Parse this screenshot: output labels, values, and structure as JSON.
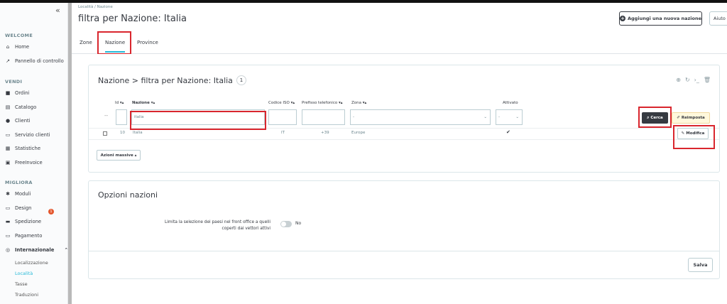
{
  "sidebar": {
    "collapse_icon": "«",
    "sections": {
      "welcome": "WELCOME",
      "vendi": "VENDI",
      "migliora": "MIGLIORA"
    },
    "items": {
      "home": "Home",
      "pannello": "Pannello di controllo",
      "ordini": "Ordini",
      "catalogo": "Catalogo",
      "clienti": "Clienti",
      "servizio": "Servizio clienti",
      "statistiche": "Statistiche",
      "freeinvoice": "FreeInvoice",
      "moduli": "Moduli",
      "design": "Design",
      "spedizione": "Spedizione",
      "pagamento": "Pagamento",
      "internazionale": "Internazionale"
    },
    "design_badge": "1",
    "subitems": {
      "localizzazione": "Localizzazione",
      "localita": "Località",
      "tasse": "Tasse",
      "traduzioni": "Traduzioni"
    }
  },
  "header": {
    "breadcrumb": "Località  /  Nazione",
    "title": "filtra per Nazione: Italia",
    "add_button": "Aggiungi una nuova nazione",
    "help_button": "Aiuto"
  },
  "tabs": {
    "zone": "Zone",
    "nazione": "Nazione",
    "province": "Province"
  },
  "list": {
    "heading": "Nazione > filtra per Nazione: Italia",
    "count": "1",
    "columns": {
      "id": "Id ▾▴",
      "nazione": "Nazione ▾▴",
      "codice": "Codice ISO ▾▴",
      "prefisso": "Prefisso telefonico ▾▴",
      "zona": "Zona ▾▴",
      "attivato": "Attivato"
    },
    "filter": {
      "dash": "--",
      "nazione_value": "italia",
      "zona_value": "-",
      "attivato_value": "-"
    },
    "row": {
      "id": "10",
      "nazione": "Italia",
      "codice": "IT",
      "prefisso": "+39",
      "zona": "Europe",
      "attivato": "✔"
    },
    "buttons": {
      "cerca": "Cerca",
      "reimposta": "Reimposta",
      "modifica": "Modifica",
      "azioni": "Azioni massive ▴"
    }
  },
  "options": {
    "heading": "Opzioni nazioni",
    "label": "Limita la selezione dei paesi nel front office a quelli coperti dai vettori attivi",
    "toggle_label": "No",
    "save": "Salva"
  },
  "colors": {
    "accent": "#25b9d7",
    "highlight": "#d9262e",
    "dark": "#363a41"
  }
}
